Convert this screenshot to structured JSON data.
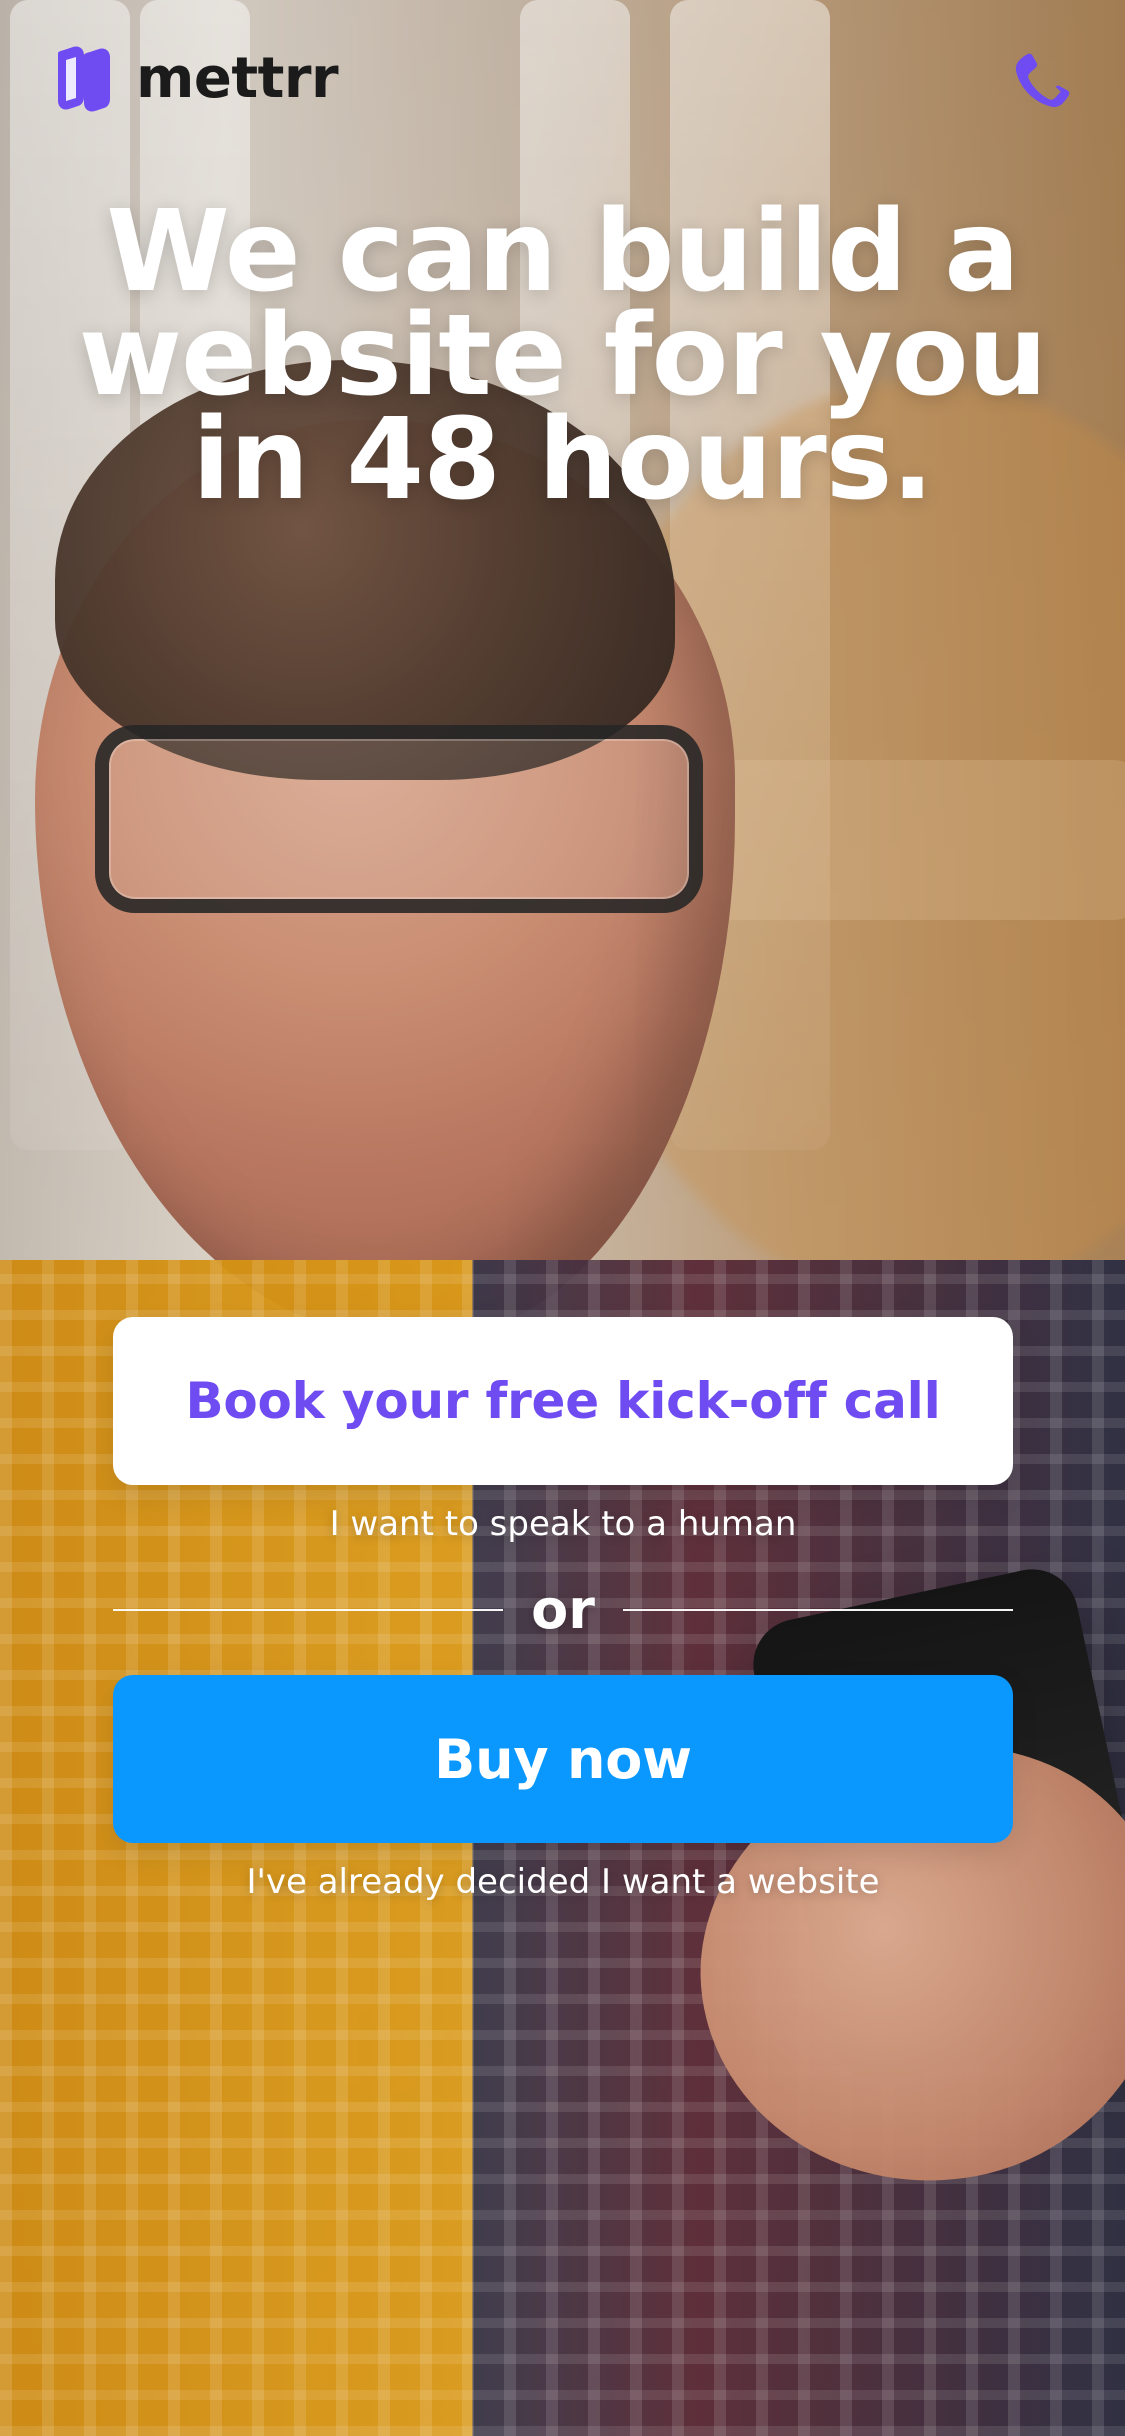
{
  "brand": {
    "name": "mettrr",
    "logo_icon": "mettrr-logo-icon",
    "accent_color": "#6f4cf2"
  },
  "header": {
    "phone_icon": "phone-icon"
  },
  "hero": {
    "title": "We can build a\nwebsite for you\nin 48 hours."
  },
  "cta": {
    "primary_label": "Book your free kick-off call",
    "primary_subtext": "I want to speak to a human",
    "divider_text": "or",
    "secondary_label": "Buy now",
    "secondary_subtext": "I've already decided I want a website",
    "secondary_color": "#0a98ff"
  }
}
